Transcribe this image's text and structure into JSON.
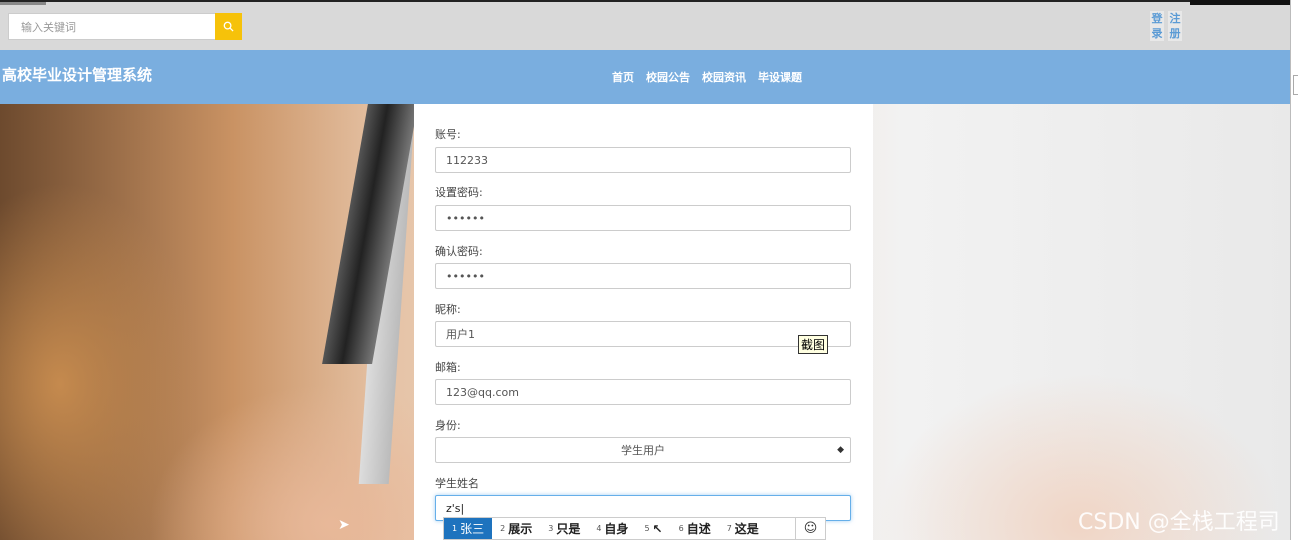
{
  "header": {
    "search_placeholder": "输入关键词",
    "login_label_1": "登",
    "login_label_2": "录",
    "register_label_1": "注",
    "register_label_2": "册"
  },
  "nav": {
    "site_title": "高校毕业设计管理系统",
    "items": [
      {
        "label": "首页"
      },
      {
        "label": "校园公告"
      },
      {
        "label": "校园资讯"
      },
      {
        "label": "毕设课题"
      }
    ]
  },
  "form": {
    "account_label": "账号:",
    "account_value": "112233",
    "password_label": "设置密码:",
    "password_value": "••••••",
    "confirm_label": "确认密码:",
    "confirm_value": "••••••",
    "nickname_label": "昵称:",
    "nickname_value": "用户1",
    "email_label": "邮箱:",
    "email_value": "123@qq.com",
    "identity_label": "身份:",
    "identity_value": "学生用户",
    "student_name_label": "学生姓名",
    "student_name_value": "z's|"
  },
  "tooltip": "截图",
  "ime": {
    "candidates": [
      {
        "num": "1",
        "text": "张三"
      },
      {
        "num": "2",
        "text": "展示"
      },
      {
        "num": "3",
        "text": "只是"
      },
      {
        "num": "4",
        "text": "自身"
      },
      {
        "num": "5",
        "text": "↖"
      },
      {
        "num": "6",
        "text": "自述"
      },
      {
        "num": "7",
        "text": "这是"
      }
    ],
    "emoji": "☺"
  },
  "watermark": "CSDN @全栈工程司"
}
